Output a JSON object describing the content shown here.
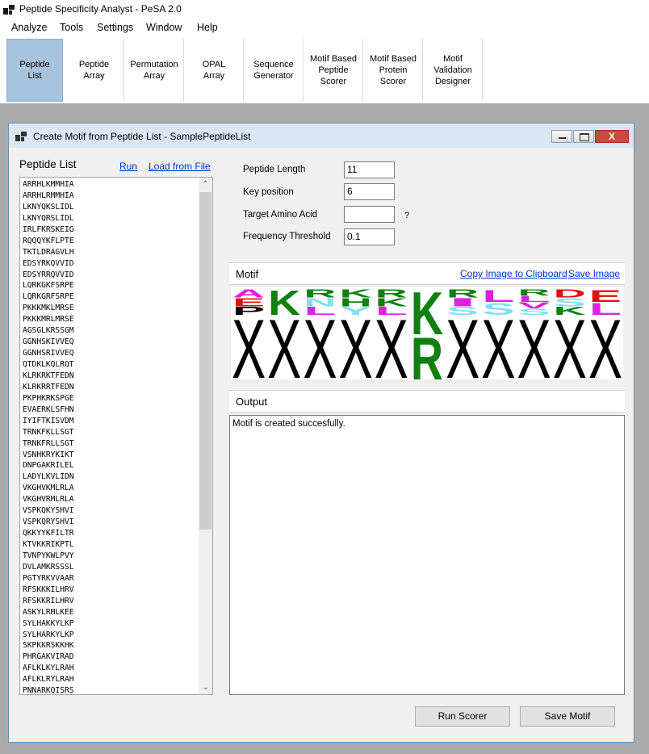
{
  "app": {
    "title": "Peptide Specificity Analyst - PeSA 2.0"
  },
  "menu": [
    "Analyze",
    "Tools",
    "Settings",
    "Window",
    "Help"
  ],
  "toolbar": [
    {
      "label": "Peptide\nList",
      "active": true
    },
    {
      "label": "Peptide\nArray"
    },
    {
      "label": "Permutation\nArray"
    },
    {
      "label": "OPAL\nArray"
    },
    {
      "label": "Sequence\nGenerator"
    },
    {
      "label": "Motif Based\nPeptide\nScorer"
    },
    {
      "label": "Motif Based\nProtein\nScorer"
    },
    {
      "label": "Motif\nValidation\nDesigner"
    }
  ],
  "child_window": {
    "title": "Create Motif from Peptide List - SamplePeptideList",
    "close_glyph": "X"
  },
  "peptide_panel": {
    "label": "Peptide List",
    "run_link": "Run",
    "load_link": "Load from File",
    "scroll_up": "⌃",
    "scroll_down": "⌄",
    "peptides": [
      "ARRHLKMMHIA",
      "ARRHLRMMHIA",
      "LKNYQKSLIDL",
      "LKNYQRSLIDL",
      "IRLFKRSKEIG",
      "RQQQYKFLPTE",
      "TKTLDRAGVLH",
      "EDSYRKQVVID",
      "EDSYRRQVVID",
      "LQRKGKFSRPE",
      "LQRKGRFSRPE",
      "PKKKMKLMRSE",
      "PKKKMRLMRSE",
      "AGSGLKRSSGM",
      "GGNHSKIVVEQ",
      "GGNHSRIVVEQ",
      "QTDKLKQLRQT",
      "KLRKRKTFEDN",
      "KLRKRRTFEDN",
      "PKPHKRKSPGE",
      "EVAERKLSFHN",
      "IYIFTKISVDM",
      "TRNKFKLLSGT",
      "TRNKFRLLSGT",
      "VSNHKRYKIKT",
      "DNPGAKRILEL",
      "LADYLKVLIDN",
      "VKGHVKMLRLA",
      "VKGHVRMLRLA",
      "VSPKQKYSHVI",
      "VSPKQRYSHVI",
      "QKKYYKFILTR",
      "KTVKKRIKPTL",
      "TVNPYKWLPVY",
      "DVLAMKRSSSL",
      "PGTYRKVVAAR",
      "RFSKKKILHRV",
      "RFSKKRILHRV",
      "ASKYLRMLKEE",
      "SYLHAKKYLKP",
      "SYLHARKYLKP",
      "SKPKKRSKKHK",
      "PHRGAKVIRAD",
      "AFLKLKYLRAH",
      "AFLKLRYLRAH",
      "PNNARKQISRS"
    ]
  },
  "fields": {
    "peptide_length": {
      "label": "Peptide Length",
      "value": "11"
    },
    "key_position": {
      "label": "Key position",
      "value": "6"
    },
    "target_amino_acid": {
      "label": "Target Amino Acid",
      "value": "",
      "hint": "?"
    },
    "frequency_threshold": {
      "label": "Frequency Threshold",
      "value": "0.1"
    }
  },
  "motif": {
    "label": "Motif",
    "copy_link": "Copy Image to Clipboard",
    "save_link": "Save Image",
    "logo_columns": [
      [
        {
          "aa": "A",
          "color": "#e020e0"
        },
        {
          "aa": "E",
          "color": "#e01010"
        },
        {
          "aa": "P",
          "color": "#000000"
        },
        {
          "aa": "X",
          "color": "#000000"
        }
      ],
      [
        {
          "aa": "K",
          "color": "#108010"
        },
        {
          "aa": "X",
          "color": "#000000"
        }
      ],
      [
        {
          "aa": "R",
          "color": "#108010"
        },
        {
          "aa": "N",
          "color": "#7fe0f0"
        },
        {
          "aa": "L",
          "color": "#e020e0"
        },
        {
          "aa": "X",
          "color": "#000000"
        }
      ],
      [
        {
          "aa": "K",
          "color": "#108010"
        },
        {
          "aa": "H",
          "color": "#108010"
        },
        {
          "aa": "Y",
          "color": "#7fe0f0"
        },
        {
          "aa": "X",
          "color": "#000000"
        }
      ],
      [
        {
          "aa": "R",
          "color": "#108010"
        },
        {
          "aa": "K",
          "color": "#108010"
        },
        {
          "aa": "L",
          "color": "#e020e0"
        },
        {
          "aa": "X",
          "color": "#000000"
        }
      ],
      [
        {
          "aa": "K",
          "color": "#108010"
        },
        {
          "aa": "R",
          "color": "#108010"
        }
      ],
      [
        {
          "aa": "R",
          "color": "#108010"
        },
        {
          "aa": "I",
          "color": "#e020e0"
        },
        {
          "aa": "S",
          "color": "#7fe0f0"
        },
        {
          "aa": "X",
          "color": "#000000"
        }
      ],
      [
        {
          "aa": "L",
          "color": "#e020e0"
        },
        {
          "aa": "S",
          "color": "#7fe0f0"
        },
        {
          "aa": "X",
          "color": "#000000"
        }
      ],
      [
        {
          "aa": "R",
          "color": "#108010"
        },
        {
          "aa": "L",
          "color": "#e020e0"
        },
        {
          "aa": "V",
          "color": "#e020e0"
        },
        {
          "aa": "S",
          "color": "#7fe0f0"
        },
        {
          "aa": "X",
          "color": "#000000"
        }
      ],
      [
        {
          "aa": "D",
          "color": "#e01010"
        },
        {
          "aa": "S",
          "color": "#7fe0f0"
        },
        {
          "aa": "K",
          "color": "#108010"
        },
        {
          "aa": "X",
          "color": "#000000"
        }
      ],
      [
        {
          "aa": "E",
          "color": "#e01010"
        },
        {
          "aa": "L",
          "color": "#e020e0"
        },
        {
          "aa": "X",
          "color": "#000000"
        }
      ]
    ]
  },
  "output": {
    "label": "Output",
    "text": "Motif is created succesfully."
  },
  "buttons": {
    "run_scorer": "Run Scorer",
    "save_motif": "Save Motif"
  }
}
